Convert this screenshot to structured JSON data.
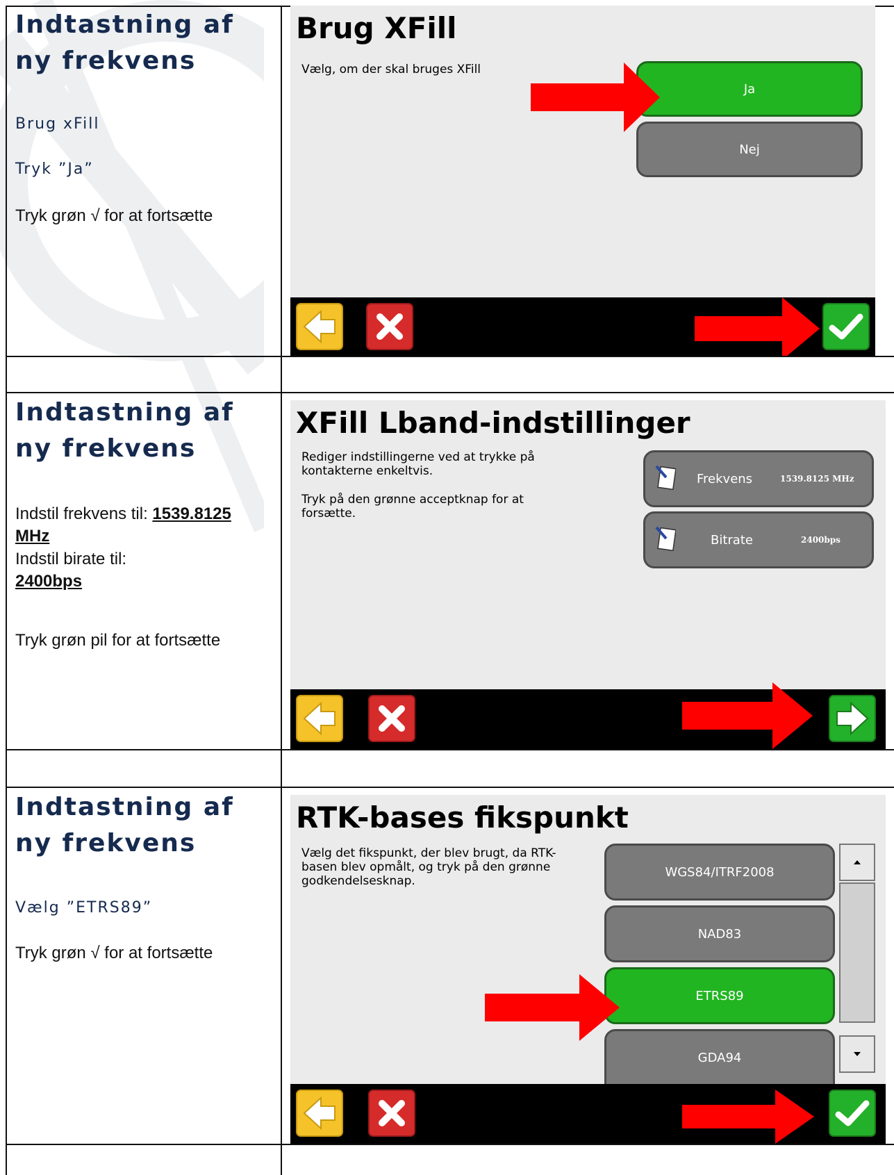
{
  "rows": [
    {
      "left": {
        "title": "Indtastning af ny frekvens",
        "line1": "Brug xFill",
        "line2": "Tryk ”Ja”",
        "line3": "Tryk grøn √ for at fortsætte"
      },
      "screen": {
        "title": "Brug XFill",
        "description": "Vælg, om der skal bruges XFill",
        "buttons": [
          "Ja",
          "Nej"
        ],
        "selected": "Ja",
        "footer_action": "check"
      }
    },
    {
      "left": {
        "title": "Indtastning af ny frekvens",
        "freq_label": "Indstil frekvens til: ",
        "freq_value": "1539.8125 MHz",
        "bitrate_label": "Indstil birate til:",
        "bitrate_value": "2400bps",
        "line3": "Tryk grøn pil for at fortsætte"
      },
      "screen": {
        "title": "XFill Lband-indstillinger",
        "description1": "Rediger indstillingerne ved at trykke på kontakterne enkeltvis.",
        "description2": "Tryk på den grønne acceptknap for at forsætte.",
        "settings": [
          {
            "label": "Frekvens",
            "value": "1539.8125 MHz"
          },
          {
            "label": "Bitrate",
            "value": "2400bps"
          }
        ],
        "footer_action": "next"
      }
    },
    {
      "left": {
        "title": "Indtastning af ny frekvens",
        "line1": "Vælg ”ETRS89”",
        "line2": "Tryk grøn √ for at fortsætte"
      },
      "screen": {
        "title": "RTK-bases fikspunkt",
        "description": "Vælg det fikspunkt, der blev brugt, da RTK-basen blev opmålt, og tryk på den grønne godkendelsesknap.",
        "options": [
          "WGS84/ITRF2008",
          "NAD83",
          "ETRS89",
          "GDA94"
        ],
        "selected": "ETRS89",
        "footer_action": "check"
      }
    }
  ],
  "icons": {
    "back": "arrow-left-icon",
    "cancel": "x-icon",
    "check": "checkmark-icon",
    "next": "arrow-right-icon",
    "edit": "notepad-pen-icon",
    "pointer": "red-arrow-icon"
  },
  "colors": {
    "heading": "#152a4e",
    "green": "#22b522",
    "gray": "#7a7a7a",
    "pointer": "#ff0000"
  }
}
